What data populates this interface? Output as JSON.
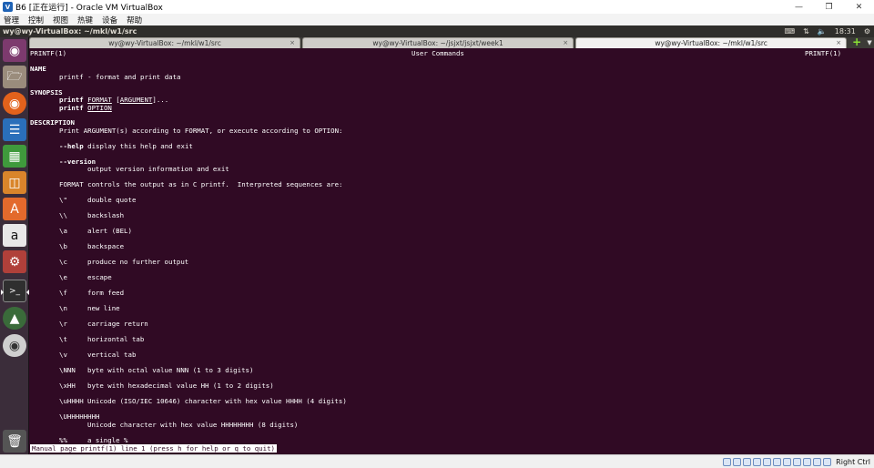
{
  "vbox": {
    "window_title": "B6 [正在运行] - Oracle VM VirtualBox",
    "menu": [
      "管理",
      "控制",
      "视图",
      "热键",
      "设备",
      "帮助"
    ],
    "host_key": "Right Ctrl"
  },
  "panel": {
    "title": "wy@wy-VirtualBox: ~/mkl/w1/src",
    "time": "18:31"
  },
  "tabs": [
    {
      "label": "wy@wy-VirtualBox: ~/mkl/w1/src",
      "active": false
    },
    {
      "label": "wy@wy-VirtualBox: ~/jsjxt/jsjxt/week1",
      "active": false
    },
    {
      "label": "wy@wy-VirtualBox: ~/mkl/w1/src",
      "active": true
    }
  ],
  "man": {
    "header_left": "PRINTF(1)",
    "header_center": "User Commands",
    "header_right": "PRINTF(1)",
    "name_heading": "NAME",
    "name_text": "printf - format and print data",
    "synopsis_heading": "SYNOPSIS",
    "syn1_cmd": "printf",
    "syn1_arg1": "FORMAT",
    "syn1_arg2": "ARGUMENT",
    "syn1_tail": "...",
    "syn2_cmd": "printf",
    "syn2_arg": "OPTION",
    "description_heading": "DESCRIPTION",
    "desc_intro": "Print ARGUMENT(s) according to FORMAT, or execute according to OPTION:",
    "help_opt": "--help",
    "help_text": " display this help and exit",
    "version_opt": "--version",
    "version_text": "output version information and exit",
    "format_intro": "FORMAT controls the output as in C printf.  Interpreted sequences are:",
    "sequences": [
      {
        "seq": "\\\"",
        "desc": "double quote"
      },
      {
        "seq": "\\\\",
        "desc": "backslash"
      },
      {
        "seq": "\\a",
        "desc": "alert (BEL)"
      },
      {
        "seq": "\\b",
        "desc": "backspace"
      },
      {
        "seq": "\\c",
        "desc": "produce no further output"
      },
      {
        "seq": "\\e",
        "desc": "escape"
      },
      {
        "seq": "\\f",
        "desc": "form feed"
      },
      {
        "seq": "\\n",
        "desc": "new line"
      },
      {
        "seq": "\\r",
        "desc": "carriage return"
      },
      {
        "seq": "\\t",
        "desc": "horizontal tab"
      },
      {
        "seq": "\\v",
        "desc": "vertical tab"
      },
      {
        "seq": "\\NNN",
        "desc": "byte with octal value NNN (1 to 3 digits)"
      },
      {
        "seq": "\\xHH",
        "desc": "byte with hexadecimal value HH (1 to 2 digits)"
      },
      {
        "seq": "\\uHHHH",
        "desc": "Unicode (ISO/IEC 10646) character with hex value HHHH (4 digits)"
      }
    ],
    "seq_long": "\\UHHHHHHHH",
    "seq_long_desc": "Unicode character with hex value HHHHHHHH (8 digits)",
    "seq_pct": "%%",
    "seq_pct_desc": "a single %",
    "status": "Manual page printf(1) line 1 (press h for help or q to quit)"
  },
  "launcher_icons": [
    "ubuntu-dash-icon",
    "files-icon",
    "firefox-icon",
    "writer-icon",
    "calc-icon",
    "impress-icon",
    "software-center-icon",
    "amazon-icon",
    "system-settings-icon",
    "terminal-icon",
    "software-updater-icon",
    "dvd-icon",
    "trash-icon"
  ],
  "colors": {
    "terminal_bg": "#300a24",
    "launcher_bg": "#3b2d3a",
    "panel_bg": "#2f2e2b"
  }
}
